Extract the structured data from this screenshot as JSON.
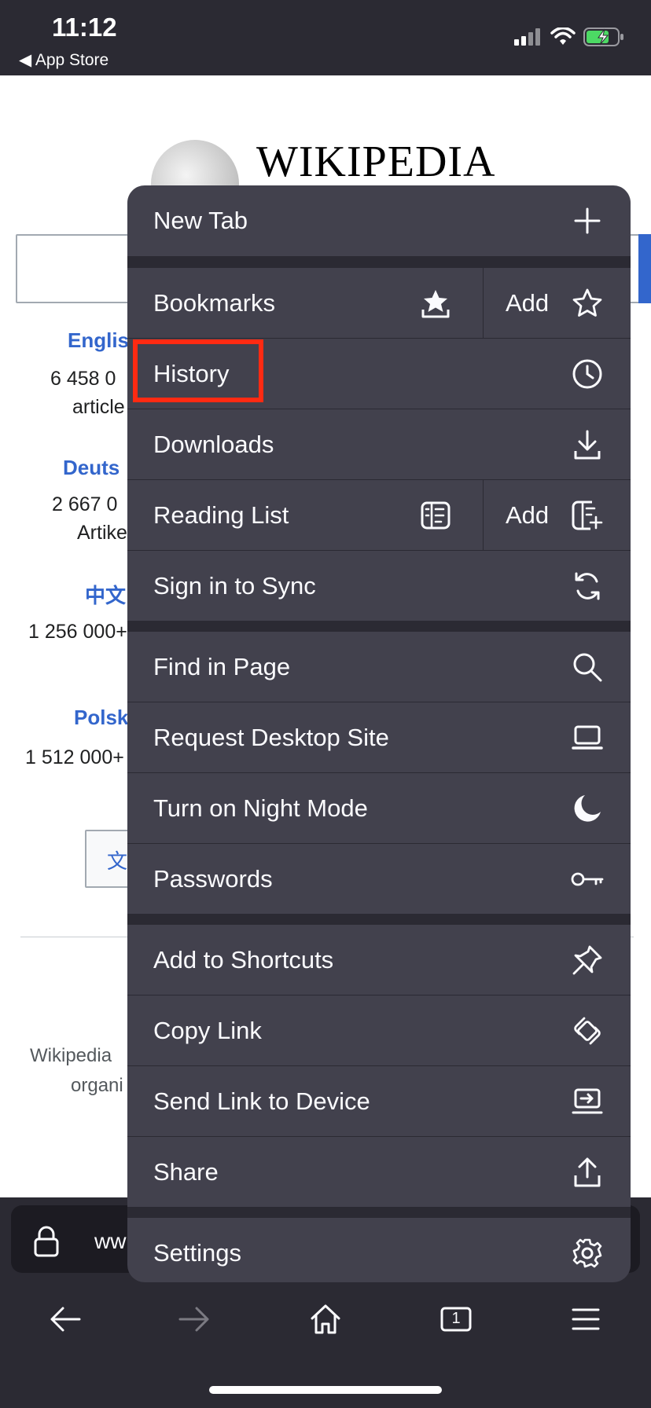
{
  "status_bar": {
    "time": "11:12",
    "back_app": "◀ App Store"
  },
  "webpage": {
    "logo_text": "WIKIPEDIA",
    "languages": [
      {
        "name": "Englis",
        "count": "6 458 0",
        "unit": "article"
      },
      {
        "name": "Deuts",
        "count": "2 667 0",
        "unit": "Artike"
      },
      {
        "name": "中文",
        "count": "1 256 000+"
      },
      {
        "name": "Polsk",
        "count": "1 512 000+"
      }
    ],
    "button_glyph": "文/",
    "footer_line1": "Wikipedia",
    "footer_line2": "organi"
  },
  "url_bar": {
    "text": "ww"
  },
  "menu": {
    "new_tab": "New Tab",
    "bookmarks": "Bookmarks",
    "bookmarks_add": "Add",
    "history": "History",
    "downloads": "Downloads",
    "reading_list": "Reading List",
    "reading_list_add": "Add",
    "sign_in_sync": "Sign in to Sync",
    "find_in_page": "Find in Page",
    "request_desktop": "Request Desktop Site",
    "night_mode": "Turn on Night Mode",
    "passwords": "Passwords",
    "add_shortcuts": "Add to Shortcuts",
    "copy_link": "Copy Link",
    "send_link": "Send Link to Device",
    "share": "Share",
    "settings": "Settings"
  },
  "toolbar": {
    "tab_count": "1"
  },
  "colors": {
    "menu_bg": "#42414d",
    "separator": "#2b2a33",
    "highlight": "#ff2a12",
    "link": "#3366cc"
  }
}
